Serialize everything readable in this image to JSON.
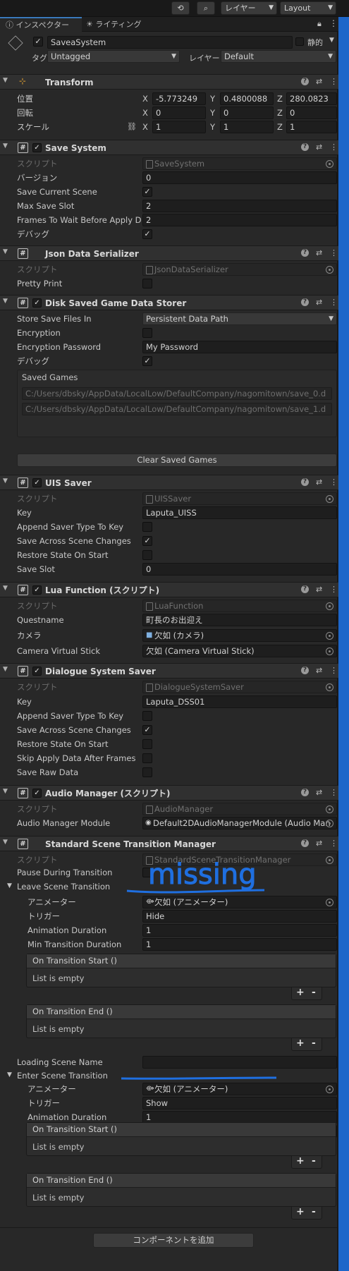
{
  "toolbar": {
    "history_icon": "history-icon",
    "search_icon": "search-icon",
    "layer_dropdown": "レイヤー",
    "layout_dropdown": "Layout"
  },
  "tabs": {
    "inspector": "インスペクター",
    "lighting": "ライティング"
  },
  "header": {
    "object_name": "SaveaSystem",
    "static_label": "静的",
    "tag_label": "タグ",
    "tag_value": "Untagged",
    "layer_label": "レイヤー",
    "layer_value": "Default"
  },
  "transform": {
    "title": "Transform",
    "position_label": "位置",
    "rotation_label": "回転",
    "scale_label": "スケール",
    "axes": {
      "x": "X",
      "y": "Y",
      "z": "Z"
    },
    "position": [
      "-5.773249",
      "0.4800088",
      "280.0823"
    ],
    "rotation": [
      "0",
      "0",
      "0"
    ],
    "scale": [
      "1",
      "1",
      "1"
    ]
  },
  "save_system": {
    "title": "Save System",
    "script_label": "スクリプト",
    "script_value": "SaveSystem",
    "version_label": "バージョン",
    "version_value": "0",
    "save_current_scene_label": "Save Current Scene",
    "max_save_slot_label": "Max Save Slot",
    "max_save_slot_value": "2",
    "frames_wait_label": "Frames To Wait Before Apply D",
    "frames_wait_value": "2",
    "debug_label": "デバッグ"
  },
  "json_serializer": {
    "title": "Json Data Serializer",
    "script_label": "スクリプト",
    "script_value": "JsonDataSerializer",
    "pretty_print_label": "Pretty Print"
  },
  "disk_storer": {
    "title": "Disk Saved Game Data Storer",
    "store_in_label": "Store Save Files In",
    "store_in_value": "Persistent Data Path",
    "encryption_label": "Encryption",
    "password_label": "Encryption Password",
    "password_value": "My Password",
    "debug_label": "デバッグ",
    "saved_games_label": "Saved Games",
    "saved_games": [
      "C:/Users/dbsky/AppData/LocalLow/DefaultCompany/nagomitown/save_0.d",
      "C:/Users/dbsky/AppData/LocalLow/DefaultCompany/nagomitown/save_1.d"
    ],
    "clear_button": "Clear Saved Games"
  },
  "uis_saver": {
    "title": "UIS Saver",
    "script_label": "スクリプト",
    "script_value": "UISSaver",
    "key_label": "Key",
    "key_value": "Laputa_UISS",
    "append_label": "Append Saver Type To Key",
    "save_across_label": "Save Across Scene Changes",
    "restore_label": "Restore State On Start",
    "save_slot_label": "Save Slot",
    "save_slot_value": "0"
  },
  "lua_function": {
    "title": "Lua Function (スクリプト)",
    "script_label": "スクリプト",
    "script_value": "LuaFunction",
    "questname_label": "Questname",
    "questname_value": "町長のお出迎え",
    "camera_label": "カメラ",
    "camera_value": "欠如 (カメラ)",
    "cvs_label": "Camera Virtual Stick",
    "cvs_value": "欠如 (Camera Virtual Stick)"
  },
  "dialogue_saver": {
    "title": "Dialogue System Saver",
    "script_label": "スクリプト",
    "script_value": "DialogueSystemSaver",
    "key_label": "Key",
    "key_value": "Laputa_DSS01",
    "append_label": "Append Saver Type To Key",
    "save_across_label": "Save Across Scene Changes",
    "restore_label": "Restore State On Start",
    "skip_label": "Skip Apply Data After Frames",
    "raw_label": "Save Raw Data"
  },
  "audio_manager": {
    "title": "Audio Manager (スクリプト)",
    "script_label": "スクリプト",
    "script_value": "AudioManager",
    "module_label": "Audio Manager Module",
    "module_value": "Default2DAudioManagerModule (Audio Man"
  },
  "transition": {
    "title": "Standard Scene Transition Manager",
    "script_label": "スクリプト",
    "script_value": "StandardSceneTransitionManager",
    "pause_label": "Pause During Transition",
    "leave_label": "Leave Scene Transition",
    "animator_label": "アニメーター",
    "animator_value": "欠如 (アニメーター)",
    "trigger_label": "トリガー",
    "leave_trigger": "Hide",
    "anim_dur_label": "Animation Duration",
    "anim_dur_value": "1",
    "min_dur_label": "Min Transition Duration",
    "min_dur_value": "1",
    "on_start": "On Transition Start ()",
    "on_end": "On Transition End ()",
    "empty": "List is empty",
    "loading_label": "Loading Scene Name",
    "enter_label": "Enter Scene Transition",
    "enter_trigger": "Show",
    "plus": "+",
    "minus": "-"
  },
  "annotation": {
    "text": "missing",
    "color": "#1f6fe0"
  },
  "add_component": "コンポーネントを追加"
}
